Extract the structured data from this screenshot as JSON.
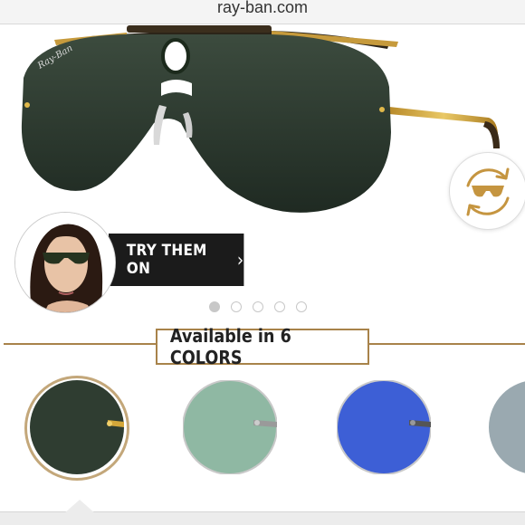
{
  "browser": {
    "url": "ray-ban.com"
  },
  "product": {
    "logo_text": "Ray-Ban"
  },
  "try_on": {
    "button_label": "TRY THEM ON",
    "chevron_icon": "chevron-right-icon"
  },
  "carousel": {
    "total": 5,
    "active_index": 0
  },
  "colors": {
    "label": "Available in 6 COLORS",
    "swatches": [
      {
        "name": "green",
        "color": "#2f3d31",
        "selected": true
      },
      {
        "name": "light-green",
        "color": "#8fb8a3",
        "selected": false
      },
      {
        "name": "blue",
        "color": "#3d5fd6",
        "selected": false
      },
      {
        "name": "grey-blue",
        "color": "#9aa9b0",
        "selected": false
      }
    ]
  }
}
